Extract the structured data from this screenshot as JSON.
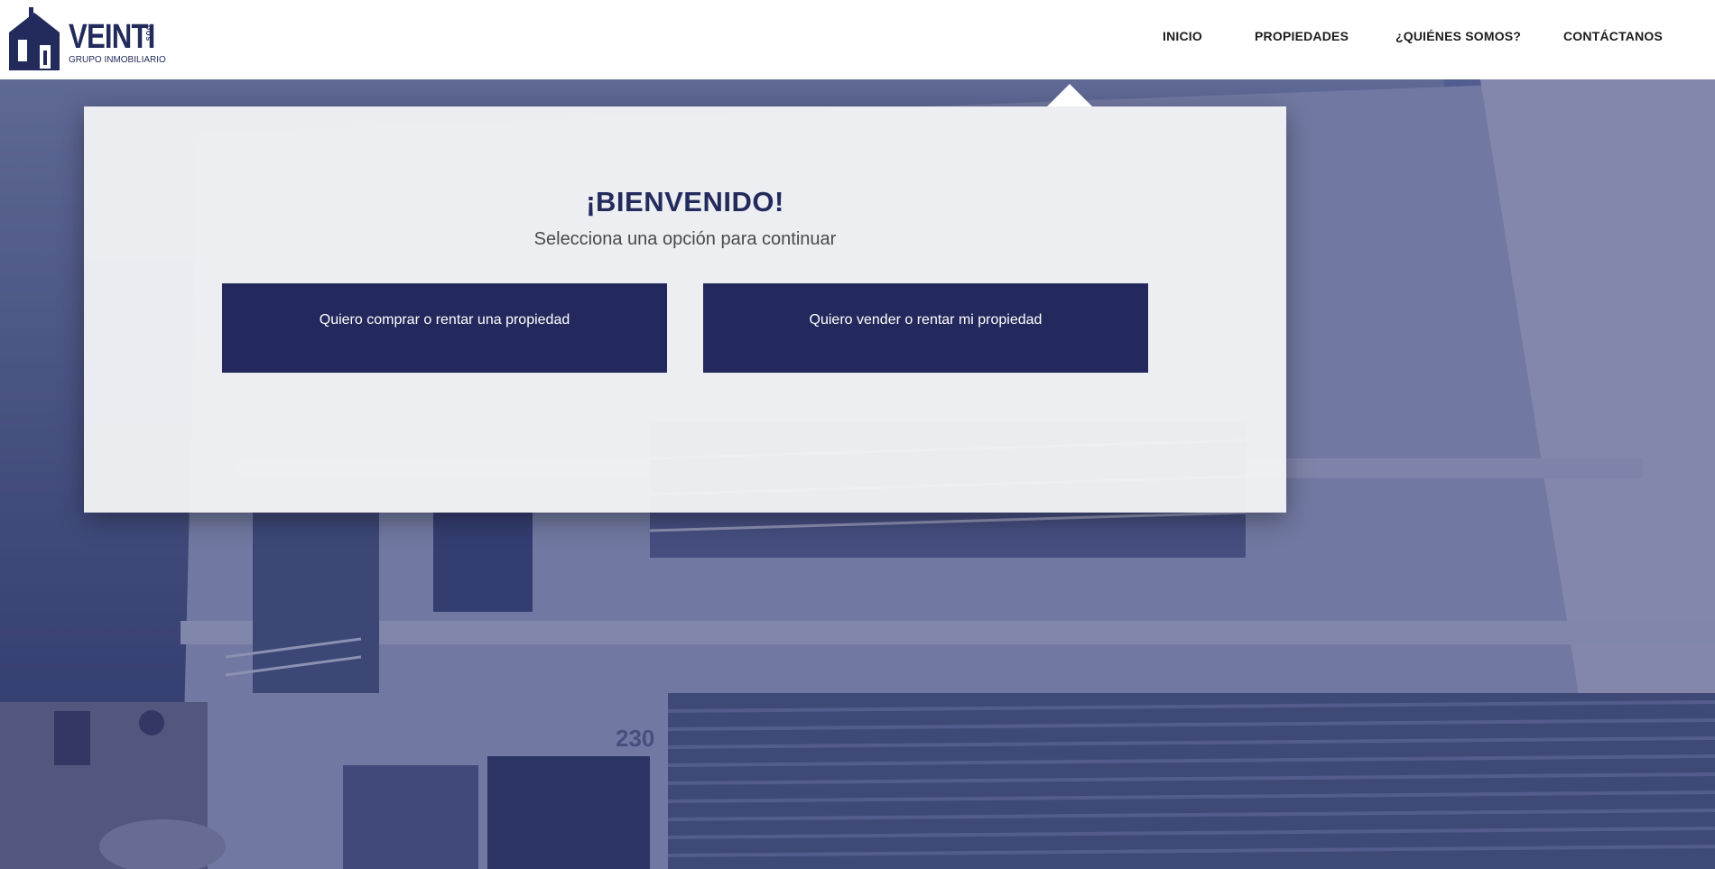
{
  "brand": {
    "name": "VEINTI",
    "tagline": "GRUPO INMOBILIARIO",
    "vertical_text": "DOS",
    "color": "#232b5c"
  },
  "nav": {
    "items": [
      {
        "label": "INICIO"
      },
      {
        "label": "PROPIEDADES"
      },
      {
        "label": "¿QUIÉNES SOMOS?"
      },
      {
        "label": "CONTÁCTANOS"
      }
    ]
  },
  "welcome": {
    "title": "¡BIENVENIDO!",
    "subtitle": "Selecciona una opción para continuar",
    "options": [
      {
        "label": "Quiero comprar o rentar una propiedad"
      },
      {
        "label": "Quiero vender o rentar mi propiedad"
      }
    ]
  },
  "hero": {
    "building_number": "230"
  },
  "colors": {
    "accent": "#23295c",
    "card_bg": "#f3f4f7",
    "header_bg": "#ffffff"
  }
}
